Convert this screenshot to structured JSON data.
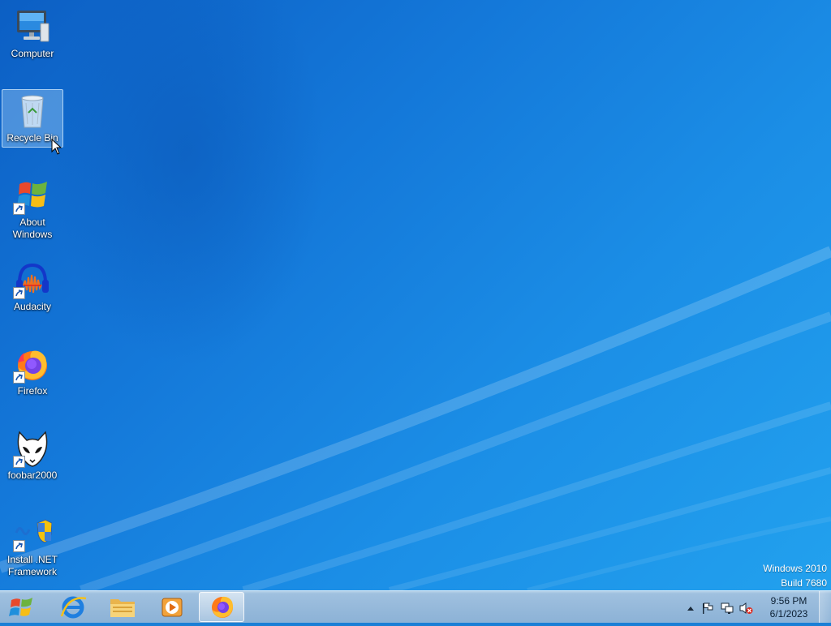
{
  "desktop": {
    "icons": [
      {
        "label": "Computer",
        "icon": "computer-icon"
      },
      {
        "label": "Recycle Bin",
        "icon": "recycle-bin-icon"
      },
      {
        "label": "About Windows",
        "icon": "windows-logo-icon"
      },
      {
        "label": "Audacity",
        "icon": "audacity-icon"
      },
      {
        "label": "Firefox",
        "icon": "firefox-icon"
      },
      {
        "label": "foobar2000",
        "icon": "foobar2000-icon"
      },
      {
        "label": "Install .NET Framework",
        "icon": "dotnet-installer-icon"
      }
    ],
    "watermark": {
      "line1": "Windows 2010",
      "line2": "Build 7680"
    }
  },
  "taskbar": {
    "pinned": [
      {
        "name": "internet-explorer",
        "icon": "internet-explorer-icon"
      },
      {
        "name": "file-explorer",
        "icon": "folder-icon"
      },
      {
        "name": "media-player",
        "icon": "media-player-icon"
      },
      {
        "name": "firefox",
        "icon": "firefox-icon",
        "active": true
      }
    ],
    "tray": {
      "icons": [
        "show-hidden-icons-arrow",
        "action-center-flag-icon",
        "network-icon",
        "volume-muted-icon"
      ],
      "time": "9:56 PM",
      "date": "6/1/2023"
    }
  },
  "colors": {
    "desktop": "#1a7fd6",
    "taskbar": "#9fc0df",
    "label_text": "#ffffff"
  }
}
